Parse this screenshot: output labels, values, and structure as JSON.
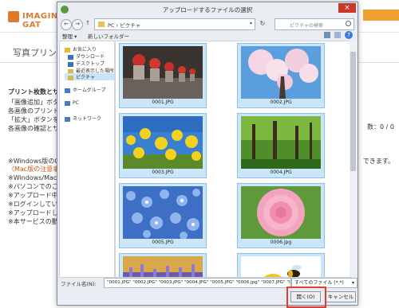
{
  "background_page": {
    "logo_text": "IMAGING GAT",
    "title": "写真プリント",
    "lines": [
      {
        "text": "プリント枚数とサイ",
        "style": "bold"
      },
      {
        "text": "「画像追加」ボタン",
        "style": "normal"
      },
      {
        "text": "各画像のプリントサ",
        "style": "normal"
      },
      {
        "text": "「拡大」ボタンを押",
        "style": "normal"
      },
      {
        "text": "各画像の確認とサイ",
        "style": "normal"
      },
      {
        "text": "※Windows版のGoo",
        "style": "normal"
      },
      {
        "text": "（Mac版の注意事項",
        "style": "orange"
      },
      {
        "text": "※Windows/Mac版",
        "style": "normal"
      },
      {
        "text": "※パソコンでのご利",
        "style": "normal"
      },
      {
        "text": "※アップロード中に",
        "style": "normal"
      },
      {
        "text": "※ログインしている",
        "style": "normal"
      },
      {
        "text": "※アップロードした",
        "style": "normal"
      },
      {
        "text": "※本サービスの動作",
        "style": "normal"
      }
    ],
    "right_count": "数：0 / 0",
    "right_note": "できます。"
  },
  "dialog": {
    "title": "アップロードするファイルの選択",
    "close_glyph": "×",
    "nav": {
      "back": "←",
      "forward": "→",
      "up": "↑"
    },
    "address_path": "PC › ピクチャ",
    "address_dropdown": "▾",
    "refresh_glyph": "↻",
    "search_placeholder": "ピクチャの検索",
    "toolbar": {
      "organize": "整理 ▾",
      "new_folder": "新しいフォルダー",
      "help": "?"
    },
    "nav_pane": [
      {
        "label": "お気に入り",
        "icon": "star-icon",
        "color": "#e8b830",
        "selected": false
      },
      {
        "label": "ダウンロード",
        "icon": "download-folder-icon",
        "color": "#3b6fc2",
        "selected": false
      },
      {
        "label": "デスクトップ",
        "icon": "desktop-icon",
        "color": "#3b6fc2",
        "selected": false
      },
      {
        "label": "最近表示した場所",
        "icon": "recent-places-icon",
        "color": "#d8b84a",
        "selected": false
      },
      {
        "label": "ピクチャ",
        "icon": "pictures-folder-icon",
        "color": "#d8b84a",
        "selected": true
      },
      {
        "label": "ホームグループ",
        "icon": "homegroup-icon",
        "color": "#3b7bd5",
        "selected": false
      },
      {
        "label": "PC",
        "icon": "pc-icon",
        "color": "#4a7ab8",
        "selected": false
      },
      {
        "label": "ネットワーク",
        "icon": "network-icon",
        "color": "#4a7ab8",
        "selected": false
      }
    ],
    "files": [
      {
        "name": "0001.JPG",
        "subject": "red knit-capped jizo statues"
      },
      {
        "name": "0002.JPG",
        "subject": "cherry blossoms"
      },
      {
        "name": "0003.JPG",
        "subject": "yellow rapeseed flowers and blue sky"
      },
      {
        "name": "0004.JPG",
        "subject": "green forest"
      },
      {
        "name": "0005.JPG",
        "subject": "blue nemophila flowers"
      },
      {
        "name": "0006.jpg",
        "subject": "pink rose"
      },
      {
        "name": "",
        "subject": "lavender field"
      },
      {
        "name": "",
        "subject": "bee on yellow flower"
      }
    ],
    "filename_label": "ファイル名(N):",
    "filename_value": "\"0001.JPG\" \"0002.JPG\" \"0003.JPG\" \"0004.JPG\" \"0005.JPG\" \"0006.jpg\" \"0007.JPG\" \"0008.JPG\"",
    "filetype_value": "すべてのファイル (*.*)",
    "filetype_arrow": "▾",
    "open_button": "開く(O)",
    "cancel_button": "キャンセル"
  }
}
